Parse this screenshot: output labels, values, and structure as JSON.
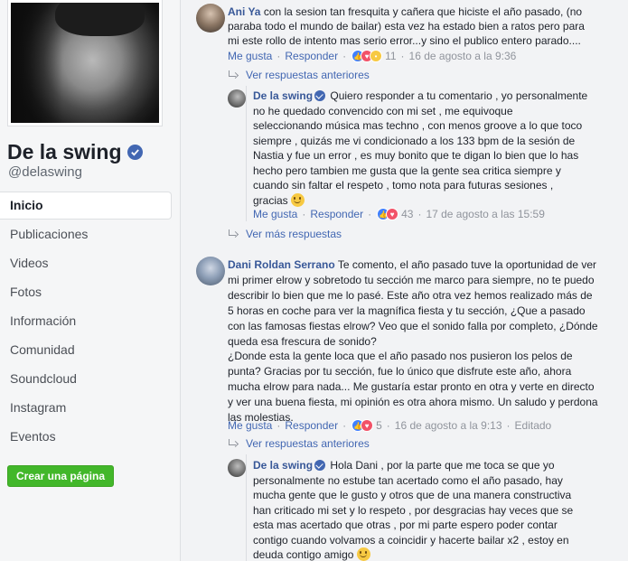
{
  "page": {
    "name": "De la swing",
    "handle": "@delaswing",
    "create_page_label": "Crear una página"
  },
  "nav": {
    "items": [
      {
        "label": "Inicio"
      },
      {
        "label": "Publicaciones"
      },
      {
        "label": "Videos"
      },
      {
        "label": "Fotos"
      },
      {
        "label": "Información"
      },
      {
        "label": "Comunidad"
      },
      {
        "label": "Soundcloud"
      },
      {
        "label": "Instagram"
      },
      {
        "label": "Eventos"
      }
    ],
    "active_index": 0
  },
  "comments": [
    {
      "author": "Ani Ya",
      "lines": [
        "con la sesion tan fresquita y cañera que hiciste el año pasado, (no",
        "paraba todo el mundo de bailar) esta vez ha estado bien a ratos pero para",
        "mi este rollo de intento mas serio error...y sino el publico entero parado...."
      ],
      "like_label": "Me gusta",
      "reply_label": "Responder",
      "reaction_count": "11",
      "time": "16 de agosto a la 9:36",
      "previous_replies_label": "Ver respuestas anteriores",
      "reply": {
        "author": "De la swing",
        "lines": [
          "Quiero responder a tu comentario , yo personalmente",
          "no he quedado convencido con mi set , me equivoque",
          "seleccionando música mas techno , con menos groove a lo que toco",
          "siempre , quizás me vi condicionado a los 133 bpm de la sesión de",
          "Nastia y fue un error , es muy bonito que te digan lo bien que lo has",
          "hecho pero tambien me gusta que la gente sea critica siempre y",
          "cuando sin faltar el respeto , tomo nota para futuras sesiones ,",
          "gracias"
        ],
        "like_label": "Me gusta",
        "reply_label": "Responder",
        "reaction_count": "43",
        "time": "17 de agosto a las 15:59"
      },
      "more_replies_label": "Ver más respuestas"
    },
    {
      "author": "Dani Roldan Serrano",
      "lines": [
        "Te comento, el año pasado tuve la oportunidad de ver",
        "mi primer elrow y sobretodo tu sección me marco para siempre, no te puedo",
        "describir lo bien que me lo pasé. Este año otra vez hemos realizado más de",
        "5 horas en coche para ver la magnífica fiesta y tu sección, ¿Que a pasado",
        "con las famosas fiestas elrow? Veo que el sonido falla por completo, ¿Dónde",
        "queda esa frescura de sonido?",
        "¿Donde esta la gente loca que el año pasado nos pusieron los pelos de",
        "punta? Gracias por tu sección, fue lo único que disfrute este año, ahora",
        "mucha elrow para nada... Me gustaría estar pronto en otra y verte en directo",
        "y ver una buena fiesta, mi opinión es otra ahora mismo. Un saludo y perdona",
        "las molestias."
      ],
      "like_label": "Me gusta",
      "reply_label": "Responder",
      "reaction_count": "5",
      "time": "16 de agosto a la 9:13",
      "edited_label": "Editado",
      "previous_replies_label": "Ver respuestas anteriores",
      "reply": {
        "author": "De la swing",
        "lines": [
          "Hola Dani , por la parte que me toca se que yo",
          "personalmente no estube tan acertado como el año pasado, hay",
          "mucha gente que le gusto y otros que de una manera constructiva",
          "han criticado mi set y lo respeto , por desgracias hay veces que se",
          "esta mas acertado que otras , por mi parte espero poder contar",
          "contigo cuando volvamos a coincidir y hacerte bailar x2 , estoy en",
          "deuda contigo amigo"
        ]
      }
    }
  ],
  "colors": {
    "link": "#385898",
    "verified": "#4267b2",
    "create_button": "#42b72a"
  }
}
